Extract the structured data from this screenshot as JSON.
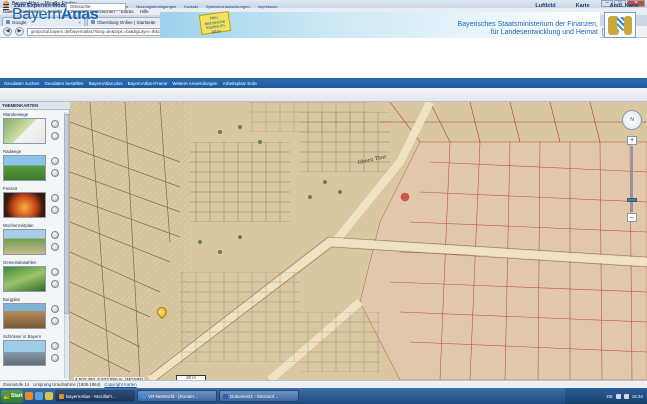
{
  "window": {
    "title": "BayernAtlas – Mozilla Firefox",
    "controls": [
      "–",
      "□",
      "✕"
    ]
  },
  "menu": [
    "Datei",
    "Bearbeiten",
    "Ansicht",
    "Chronik",
    "Lesezeichen",
    "Extras",
    "Hilfe"
  ],
  "tabs": [
    {
      "label": "Google",
      "active": false
    },
    {
      "label": "Obernburg Online | Startseite",
      "active": false
    },
    {
      "label": "BayernAtlas",
      "active": true
    },
    {
      "label": "Flurzettelung 1845",
      "active": false
    }
  ],
  "urlbar": {
    "url": "geoportal.bayern.de/bayernatlas/?lang=de&topic=ba&bgLayer=tk&catalogNodes=11,122&E=4507395.62&N=5527210.72&zoom=12&layers=KML%7C%7Chttp…",
    "search": "hoc obernburg"
  },
  "site": {
    "logo_bayern": "Bayern",
    "logo_atlas": "Atlas",
    "top_links": [
      "Startseite GeoportalBayern",
      "Nutzungsbedingungen",
      "Kontakt",
      "Systemvoraussetzungen",
      "Impressum"
    ],
    "badge": "Neu: historische Karten im Atlas",
    "ministry_line1": "Bayerisches Staatsministerium der Finanzen,",
    "ministry_line2": "für Landesentwicklung und Heimat"
  },
  "nav": [
    "Geodaten suchen",
    "Geodaten bestellen",
    "BayernAtlas-plus",
    "BayernAtlas-iFrame",
    "Weitere Anwendungen",
    "Arbeitsplatz Erde"
  ],
  "toolbar": {
    "expert": "Zum Experten-Modus",
    "place": "Ortssuche",
    "views": [
      "Luftbild",
      "Karte",
      "Amtl. Karte"
    ]
  },
  "sidebar": {
    "header": "THEMENKARTEN",
    "themes": [
      {
        "label": "Wanderwege"
      },
      {
        "label": "Radwege"
      },
      {
        "label": "Freizeit"
      },
      {
        "label": "Wochenzeitplan"
      },
      {
        "label": "Gemeindewahlen"
      },
      {
        "label": "Burgplan"
      },
      {
        "label": "Schlösser in Bayern"
      }
    ]
  },
  "map": {
    "labels": [
      "Obern Thor"
    ],
    "compass": "N",
    "zoom_plus": "+",
    "zoom_minus": "–",
    "coords": "4 507 393, 5 527 850 m, (MGS84)",
    "scale": "20 m"
  },
  "status": {
    "zoom": "Zoomstufe 14",
    "source": "Ursprung Uraufnahme (1808-1864)",
    "copyright": "Copyright Karten"
  },
  "taskbar": {
    "start": "Start",
    "tasks": [
      "BayernAtlas - MozillaFi…",
      "VR-NetWorld - [Konten…",
      "Dokument1 - Microsof…"
    ],
    "clock": "16:34",
    "lang": "DE"
  },
  "colors": {
    "brand_blue": "#1e66b3",
    "nav_blue": "#1f5a9f",
    "parchment": "#d9c7a2",
    "parcel_red": "#b13a2f"
  }
}
